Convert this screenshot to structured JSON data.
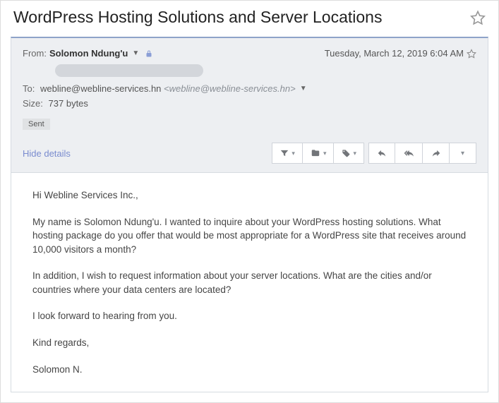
{
  "subject": "WordPress Hosting Solutions and Server Locations",
  "meta": {
    "from_label": "From:",
    "sender_name": "Solomon Ndung'u",
    "date": "Tuesday, March 12, 2019 6:04 AM",
    "to_label": "To:",
    "recipient_display": "webline@webline-services.hn",
    "recipient_raw": "<webline@webline-services.hn>",
    "size_label": "Size:",
    "size_value": "737 bytes",
    "sent_chip": "Sent",
    "hide_details": "Hide details"
  },
  "body": {
    "p1": "Hi Webline Services Inc.,",
    "p2": "My name is Solomon Ndung'u. I wanted to inquire about your WordPress hosting solutions. What hosting package do you offer that would be most appropriate for a WordPress site that receives around 10,000 visitors a month?",
    "p3": "In addition, I wish to request information about your server locations. What are the cities and/or countries where your data centers are located?",
    "p4": "I look forward to hearing from you.",
    "p5": "Kind regards,",
    "p6": "Solomon N."
  }
}
